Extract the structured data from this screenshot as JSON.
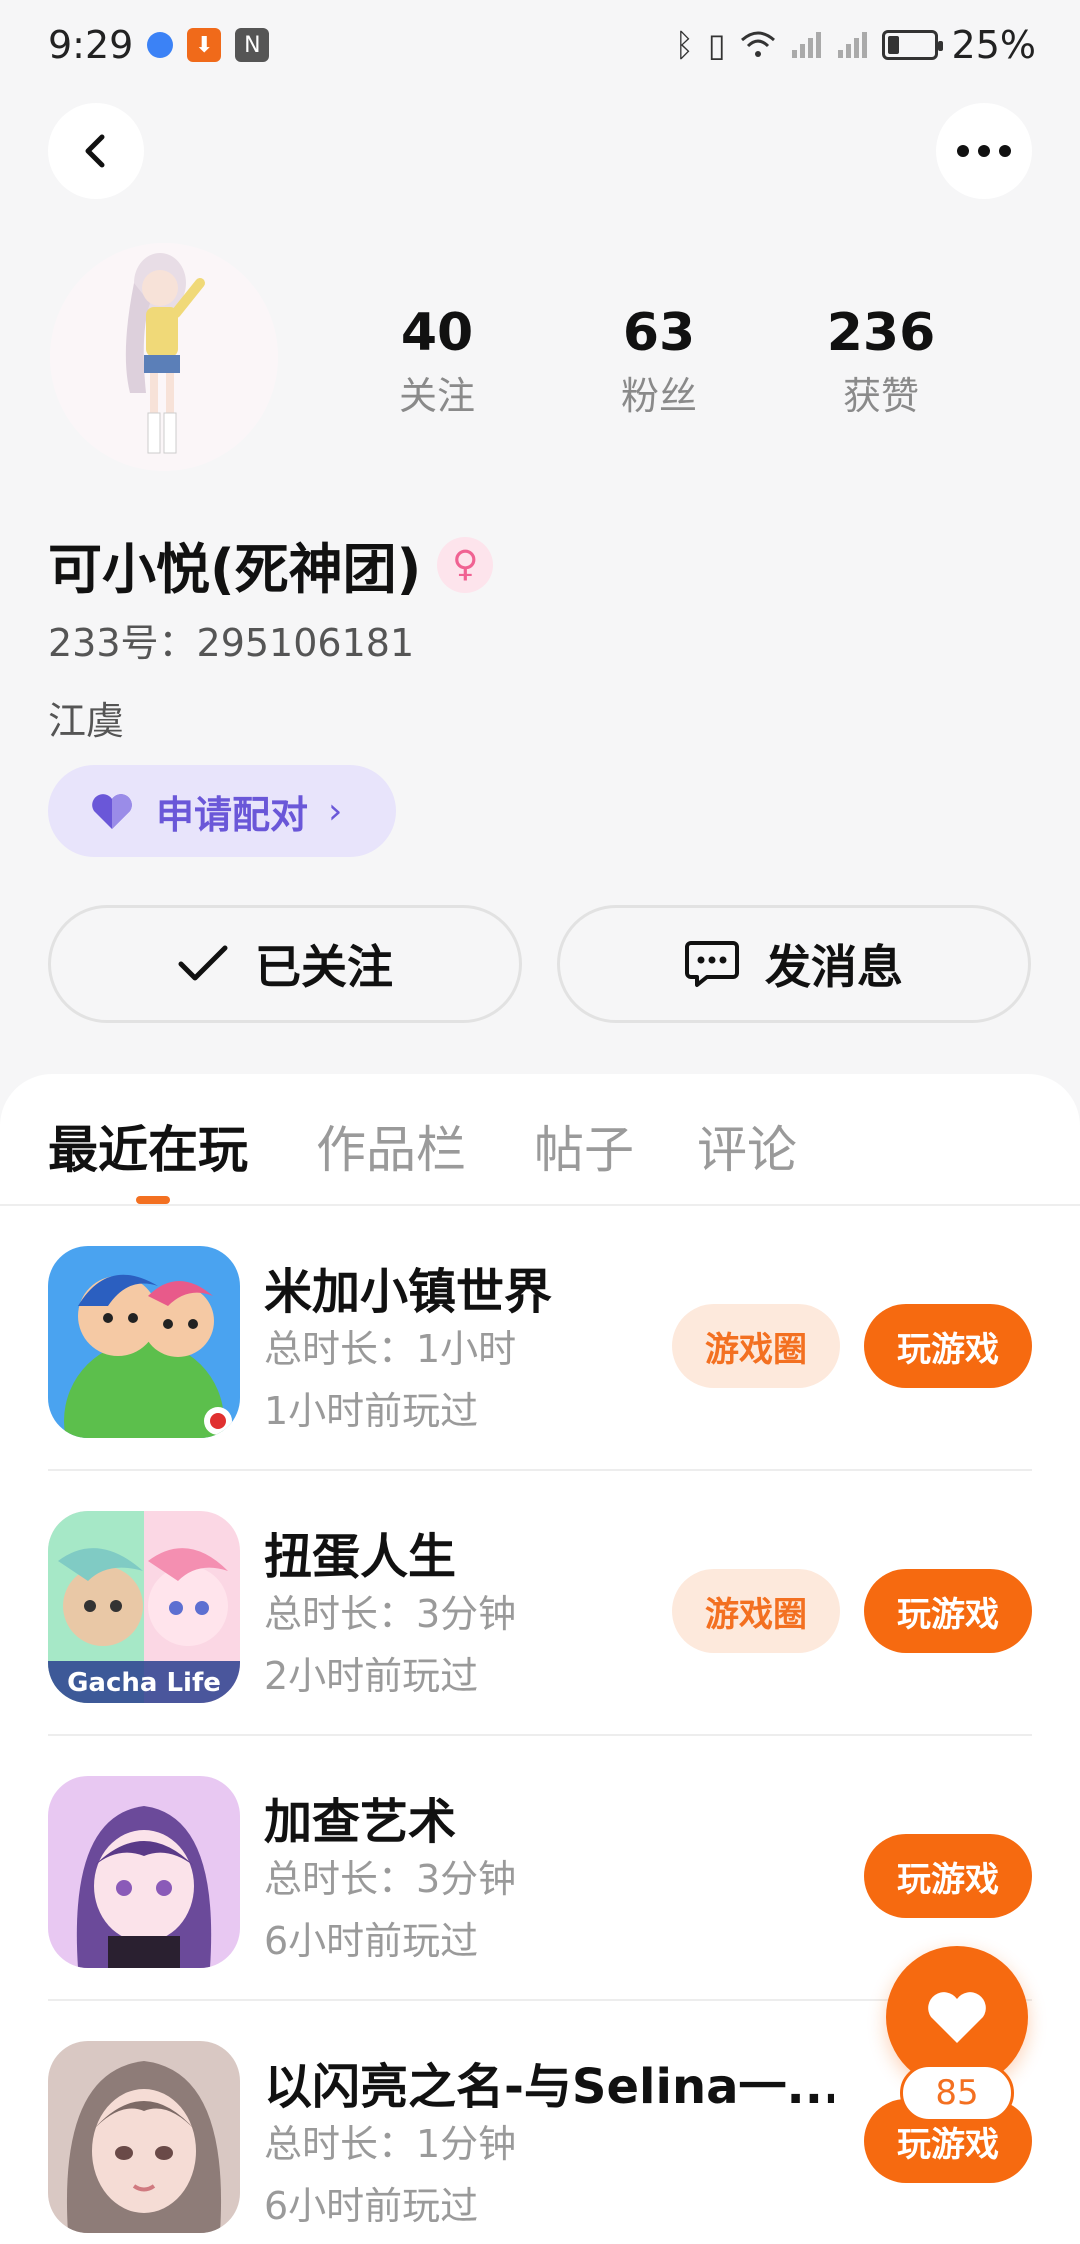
{
  "status_bar": {
    "time": "9:29",
    "battery": "25%",
    "battery_level": 0.25,
    "icons": [
      "browser-icon",
      "download-icon",
      "nfc-icon",
      "bluetooth-icon",
      "vibrate-icon",
      "wifi-icon",
      "signal-icon",
      "signal-icon",
      "battery-icon"
    ]
  },
  "header": {
    "back_icon": "back-arrow-icon",
    "more_icon": "more-dots-icon"
  },
  "profile": {
    "stats": [
      {
        "value": "40",
        "label": "关注"
      },
      {
        "value": "63",
        "label": "粉丝"
      },
      {
        "value": "236",
        "label": "获赞"
      }
    ],
    "name": "可小悦(死神团)",
    "gender_icon": "female-icon",
    "id_line": "233号：295106181",
    "location": "江虞",
    "pair_button": "申请配对",
    "follow_button": "已关注",
    "message_button": "发消息"
  },
  "tabs": [
    "最近在玩",
    "作品栏",
    "帖子",
    "评论"
  ],
  "active_tab": 0,
  "games": [
    {
      "title": "米加小镇世界",
      "time": "总时长：1小时",
      "last_played": "1小时前玩过",
      "circle_label": "游戏圈",
      "play_label": "玩游戏",
      "has_circle": true
    },
    {
      "title": "扭蛋人生",
      "time": "总时长：3分钟",
      "last_played": "2小时前玩过",
      "circle_label": "游戏圈",
      "play_label": "玩游戏",
      "has_circle": true
    },
    {
      "title": "加查艺术",
      "time": "总时长：3分钟",
      "last_played": "6小时前玩过",
      "play_label": "玩游戏",
      "has_circle": false
    },
    {
      "title": "以闪亮之名-与Selina一...",
      "time": "总时长：1分钟",
      "last_played": "6小时前玩过",
      "play_label": "玩游戏",
      "has_circle": false
    }
  ],
  "like_fab": {
    "count": "85",
    "icon": "heart-icon"
  },
  "colors": {
    "accent": "#f66a10",
    "accent_soft": "#fde9dc",
    "pair_bg": "#e8e4fb",
    "pair_text": "#6a57d8",
    "background": "#f6f6f7"
  }
}
